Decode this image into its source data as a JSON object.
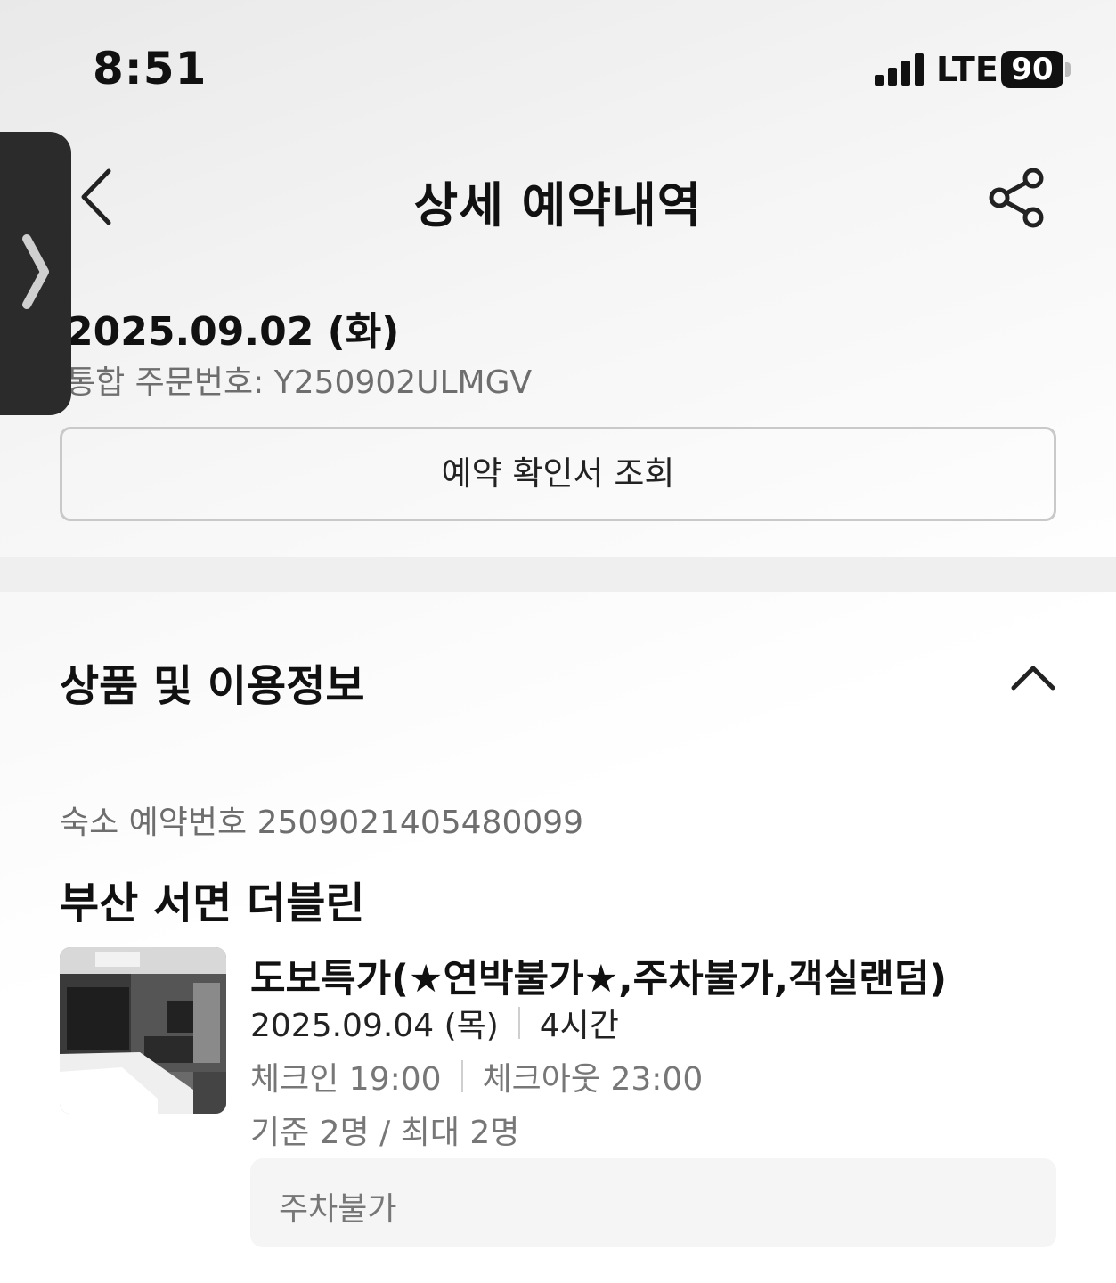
{
  "status_bar": {
    "time": "8:51",
    "network": "LTE",
    "battery": "90"
  },
  "header": {
    "title": "상세 예약내역",
    "back_icon": "chevron-left-icon",
    "share_icon": "share-icon"
  },
  "side_handle": {
    "icon": "chevron-right-icon"
  },
  "order": {
    "date": "2025.09.02 (화)",
    "order_number": "통합 주문번호: Y250902ULMGV",
    "confirm_button_label": "예약 확인서 조회"
  },
  "section": {
    "title": "상품 및 이용정보",
    "toggle_icon": "chevron-up-icon"
  },
  "stay": {
    "reservation_number": "숙소 예약번호 2509021405480099",
    "hotel_name": "부산 서면 더블린",
    "room_name": "도보특가(★연박불가★,주차불가,객실랜덤)",
    "use_date": "2025.09.04 (목)",
    "duration": "4시간",
    "check_in": "체크인 19:00",
    "check_out": "체크아웃 23:00",
    "capacity": "기준 2명 / 최대 2명",
    "notice": "주차불가"
  }
}
